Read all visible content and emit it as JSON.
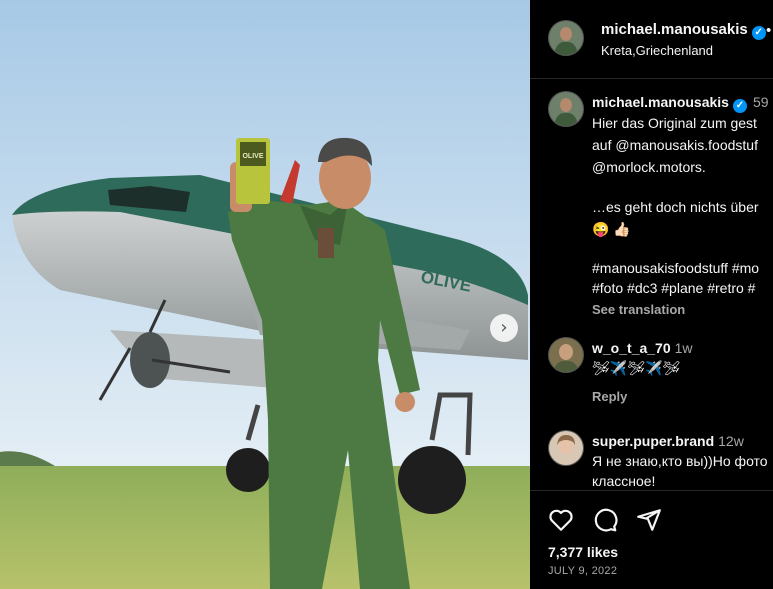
{
  "post": {
    "username": "michael.manousakis",
    "location": "Kreta,Griechenland",
    "more_dot": "•",
    "verified_mark": "✓",
    "plane_lettering": "OLIVE",
    "can_label": "OLIVE"
  },
  "caption": {
    "username": "michael.manousakis",
    "age": "59",
    "lines": [
      "Hier das Original zum gest",
      "auf @manousakis.foodstuf",
      "@morlock.motors.",
      "…es geht doch nichts über",
      "😜 👍🏻",
      "#manousakisfoodstuff #mo",
      "#foto #dc3 #plane #retro #"
    ],
    "see_translation": "See translation"
  },
  "comments": [
    {
      "username": "w_o_t_a_70",
      "age": "1w",
      "text": "🛩✈️🛩✈️🛩",
      "reply": "Reply"
    },
    {
      "username": "super.puper.brand",
      "age": "12w",
      "text": "Я не знаю,кто вы))Но фото",
      "text2": "классное!"
    }
  ],
  "actions": {
    "likes": "7,377 likes",
    "date": "JULY 9, 2022",
    "icons": [
      "heart-icon",
      "comment-icon",
      "share-icon"
    ]
  },
  "colors": {
    "background": "#000000",
    "text": "#f5f5f5",
    "muted": "#a8a8a8",
    "verified": "#0095f6",
    "plane_green": "#2f6b5a",
    "overall_green": "#4d7a43"
  }
}
